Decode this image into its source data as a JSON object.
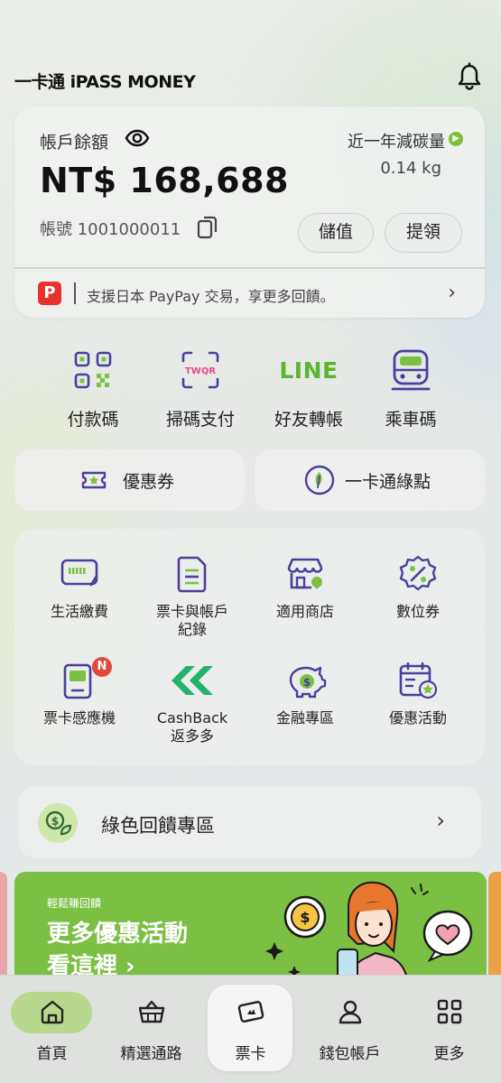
{
  "header": {
    "logo_text": "一卡通 iPASS MONEY"
  },
  "account": {
    "balance_label": "帳戶餘額",
    "balance_amount": "NT$ 168,688",
    "account_number": "帳號 1001000011",
    "carbon_label": "近一年減碳量",
    "carbon_value": "0.14 kg",
    "deposit_label": "儲值",
    "withdraw_label": "提領",
    "paypay_text": "支援日本 PayPay 交易，享更多回饋。"
  },
  "quick_actions": [
    {
      "label": "付款碼",
      "icon": "qr-code-icon"
    },
    {
      "label": "掃碼支付",
      "icon": "twqr-scan-icon"
    },
    {
      "label": "好友轉帳",
      "icon": "line-icon",
      "icon_text": "LINE"
    },
    {
      "label": "乘車碼",
      "icon": "train-icon"
    }
  ],
  "shortcuts": {
    "coupon_label": "優惠券",
    "green_points_label": "一卡通綠點"
  },
  "services": [
    {
      "label": "生活繳費",
      "icon": "bill-icon"
    },
    {
      "label": "票卡與帳戶紀錄",
      "label_lines": [
        "票卡與帳戶",
        "紀錄"
      ],
      "icon": "document-icon"
    },
    {
      "label": "適用商店",
      "icon": "store-icon"
    },
    {
      "label": "數位券",
      "icon": "digital-coupon-icon"
    },
    {
      "label": "票卡感應機",
      "icon": "card-reader-icon",
      "badge": "N"
    },
    {
      "label": "CashBack返多多",
      "label_lines": [
        "CashBack",
        "返多多"
      ],
      "icon": "cashback-icon"
    },
    {
      "label": "金融專區",
      "icon": "piggy-bank-icon"
    },
    {
      "label": "優惠活動",
      "icon": "calendar-star-icon"
    }
  ],
  "green_feedback": {
    "label": "綠色回饋專區"
  },
  "banner": {
    "small_text": "輕鬆賺回饋",
    "line1": "更多優惠活動",
    "line2": "看這裡 ›"
  },
  "bottom_nav": [
    {
      "label": "首頁",
      "icon": "home-icon",
      "active": true
    },
    {
      "label": "精選通路",
      "icon": "basket-icon"
    },
    {
      "label": "票卡",
      "icon": "card-icon"
    },
    {
      "label": "錢包帳戶",
      "icon": "user-icon"
    },
    {
      "label": "更多",
      "icon": "grid-icon"
    }
  ],
  "colors": {
    "accent_purple": "#4a3f9e",
    "accent_green": "#7bc043",
    "paypay_red": "#e8322f",
    "badge_red": "#e0473e"
  }
}
